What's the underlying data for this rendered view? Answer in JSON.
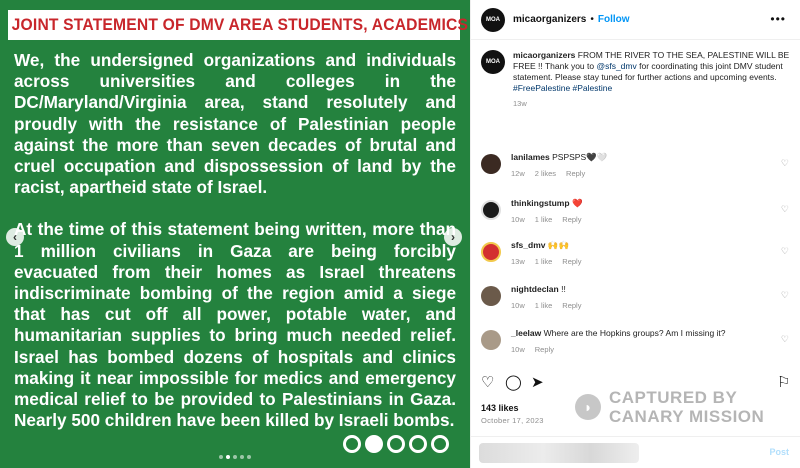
{
  "media": {
    "banner": "JOINT STATEMENT OF DMV AREA  STUDENTS, ACADEMICS & FACULTY:",
    "paragraph_1": "We, the undersigned organizations and individuals across universities and colleges in the DC/Maryland/Virginia area, stand resolutely and proudly with the resistance of Palestinian people against the more than seven decades of brutal and cruel occupation and dispossession of land by the racist, apartheid state of Israel.",
    "paragraph_2": "At the time of this statement being written, more than 1 million civilians in Gaza are being forcibly evacuated from their homes as Israel threatens indiscriminate bombing of the region amid a siege that has cut off all power, potable water, and humanitarian supplies to bring much needed relief. Israel has bombed dozens of hospitals and clinics making it near impossible for medics and emergency medical relief to be provided to Palestinians in Gaza. Nearly 500 children have been killed by Israeli bombs.",
    "prev_icon": "chevron-left-icon",
    "next_icon": "chevron-right-icon",
    "slide_index": 2,
    "slide_count": 5,
    "background_color": "#24823e"
  },
  "header": {
    "avatar_text": "MOA",
    "username": "micaorganizers",
    "separator": "•",
    "follow_label": "Follow",
    "more_icon": "more-horizontal-icon"
  },
  "caption": {
    "username": "micaorganizers",
    "text_1": "FROM THE RIVER TO THE SEA, PALESTINE WILL BE FREE !! Thank you to ",
    "mention": "@sfs_dmv",
    "text_2": " for coordinating this joint DMV student statement. Please stay tuned for further actions and upcoming events.",
    "hashtags": "#FreePalestine #Palestine",
    "time": "13w"
  },
  "comments": [
    {
      "username": "lanilames",
      "text": "PSPSPS🖤🤍",
      "time": "12w",
      "likes": "2 likes",
      "reply": "Reply"
    },
    {
      "username": "thinkingstump",
      "text": "❤️",
      "time": "10w",
      "likes": "1 like",
      "reply": "Reply"
    },
    {
      "username": "sfs_dmv",
      "text": "🙌🙌",
      "time": "13w",
      "likes": "1 like",
      "reply": "Reply"
    },
    {
      "username": "nightdeclan",
      "text": "!!",
      "time": "10w",
      "likes": "1 like",
      "reply": "Reply"
    },
    {
      "username": "_leelaw",
      "text": "Where are the Hopkins groups? Am I missing it?",
      "time": "10w",
      "likes": "",
      "reply": "Reply"
    }
  ],
  "actions": {
    "like_icon": "heart-icon",
    "comment_icon": "comment-icon",
    "share_icon": "send-icon",
    "save_icon": "bookmark-icon"
  },
  "likes": "143 likes",
  "date": "October 17, 2023",
  "composer": {
    "post_label": "Post"
  },
  "watermark": {
    "line_1": "CAPTURED BY",
    "line_2": "CANARY MISSION"
  }
}
